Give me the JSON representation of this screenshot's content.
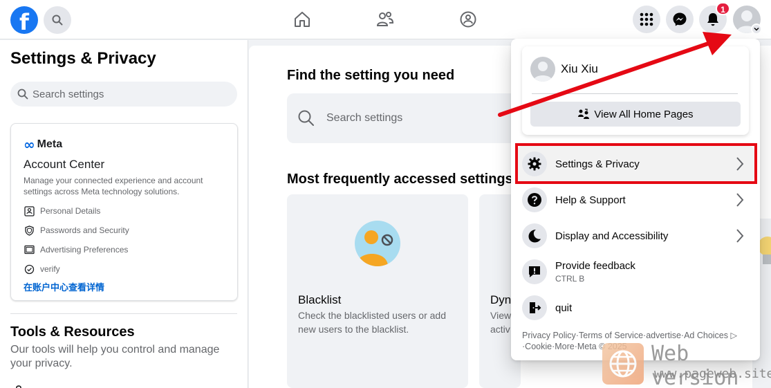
{
  "nav": {
    "logo": "f",
    "notification_count": "1"
  },
  "sidebar": {
    "title": "Settings & Privacy",
    "search_placeholder": "Search settings",
    "account_center": {
      "brand": "Meta",
      "title": "Account Center",
      "description": "Manage your connected experience and account settings across Meta technology solutions.",
      "items": [
        {
          "label": "Personal Details",
          "icon": "id-card-icon"
        },
        {
          "label": "Passwords and Security",
          "icon": "shield-icon"
        },
        {
          "label": "Advertising Preferences",
          "icon": "monitor-icon"
        },
        {
          "label": "verify",
          "icon": "check-circle-icon"
        }
      ],
      "link": "在账户中心查看详情"
    },
    "tools_title": "Tools & Resources",
    "tools_description": "Our tools will help you control and manage your privacy."
  },
  "main": {
    "find_title": "Find the setting you need",
    "search_placeholder": "Search settings",
    "frequent_title": "Most frequently accessed settings",
    "cards": [
      {
        "title": "Blacklist",
        "description": "Check the blacklisted users or add new users to the blacklist."
      },
      {
        "title": "Dyn",
        "description_line1": "View",
        "description_line2": "activ"
      }
    ]
  },
  "dropdown": {
    "profile_name": "Xiu Xiu",
    "view_all_label": "View All Home Pages",
    "menu": [
      {
        "label": "Settings & Privacy",
        "icon": "gear-icon",
        "has_chevron": true
      },
      {
        "label": "Help & Support",
        "icon": "help-icon",
        "has_chevron": true
      },
      {
        "label": "Display and Accessibility",
        "icon": "moon-icon",
        "has_chevron": true
      },
      {
        "label": "Provide feedback",
        "sub": "CTRL B",
        "icon": "feedback-icon",
        "has_chevron": false
      },
      {
        "label": "quit",
        "icon": "logout-icon",
        "has_chevron": false
      }
    ],
    "footer_line1": "Privacy Policy·Terms of Service·advertise·Ad Choices",
    "footer_line2": "·Cookie·More·Meta © 2025"
  },
  "watermark": {
    "line1": "Web version",
    "line2": "www.pageweb.site"
  },
  "colors": {
    "brand_blue": "#1877f2",
    "highlight_red": "#e50914",
    "badge_red": "#e41e3f"
  }
}
